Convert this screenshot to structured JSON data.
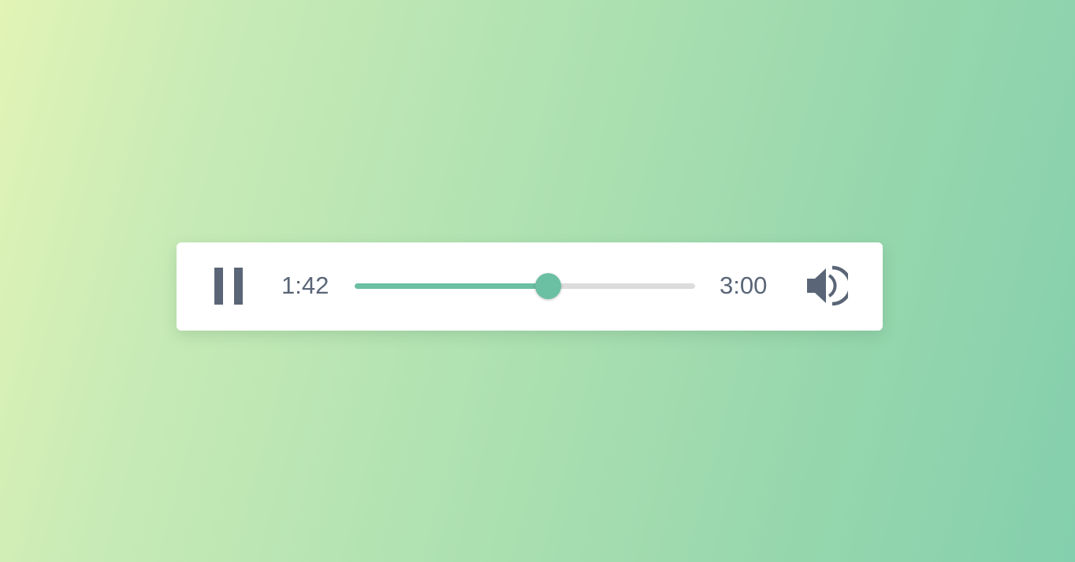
{
  "player": {
    "current_time": "1:42",
    "total_time": "3:00",
    "progress_fraction": 0.567,
    "state": "playing",
    "icons": {
      "play_pause": "pause-icon",
      "volume": "volume-icon"
    }
  },
  "colors": {
    "accent": "#6bbfa3",
    "icon": "#5a6677",
    "track": "#dcdcdc",
    "card": "#ffffff",
    "background_start": "#e2f4b6",
    "background_end": "#84cfad"
  }
}
